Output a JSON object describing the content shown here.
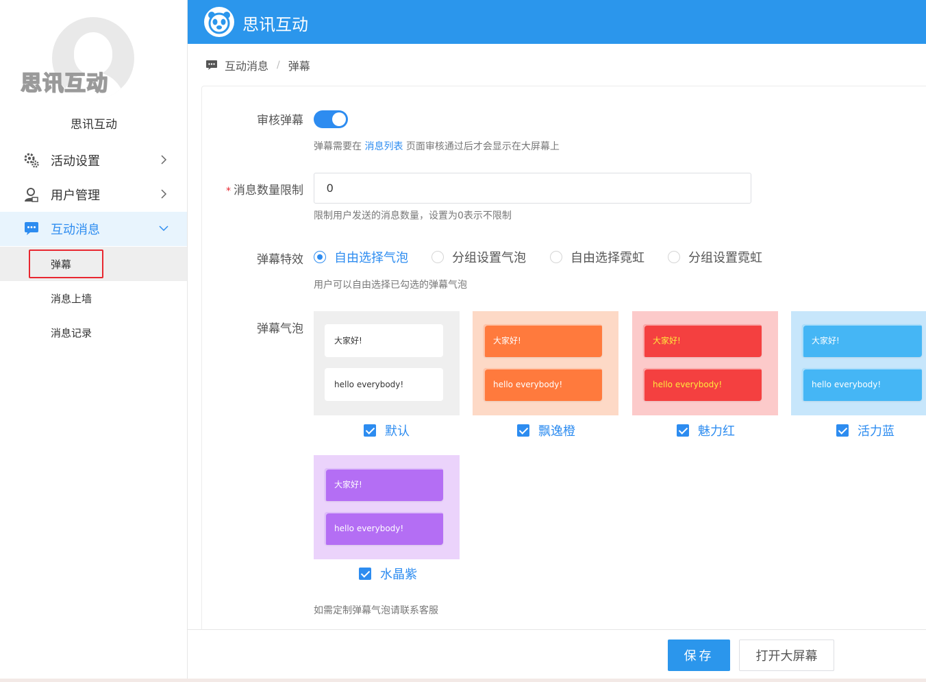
{
  "sidebar": {
    "avatar_logo_text": "思讯互动",
    "account_name": "思讯互动",
    "nav": [
      {
        "label": "活动设置",
        "icon": "gears-icon"
      },
      {
        "label": "用户管理",
        "icon": "user-manage-icon"
      },
      {
        "label": "互动消息",
        "icon": "chat-bubble-icon",
        "active": true
      }
    ],
    "sub_items": [
      {
        "label": "弹幕",
        "selected": true
      },
      {
        "label": "消息上墙"
      },
      {
        "label": "消息记录"
      }
    ]
  },
  "header": {
    "title": "思讯互动",
    "logo_icon": "panda-logo-icon",
    "color": "#2b96ec"
  },
  "breadcrumb": {
    "icon": "chat-icon",
    "parent": "互动消息",
    "separator": "/",
    "current": "弹幕"
  },
  "form": {
    "review": {
      "label": "审核弹幕",
      "enabled": true,
      "help_prefix": "弹幕需要在",
      "help_link": "消息列表",
      "help_suffix": "页面审核通过后才会显示在大屏幕上"
    },
    "limit": {
      "required_mark": "*",
      "label": "消息数量限制",
      "value": "0",
      "help": "限制用户发送的消息数量，设置为0表示不限制"
    },
    "effect": {
      "label": "弹幕特效",
      "options": [
        "自由选择气泡",
        "分组设置气泡",
        "自由选择霓虹",
        "分组设置霓虹"
      ],
      "selected": "自由选择气泡",
      "help": "用户可以自由选择已勾选的弹幕气泡"
    },
    "bubbles": {
      "label": "弹幕气泡",
      "line1": "大家好!",
      "line2": "hello everybody!",
      "items": [
        {
          "name": "默认",
          "checked": true,
          "bg": "#efefef",
          "bubble": "#ffffff",
          "text": "#333333"
        },
        {
          "name": "飘逸橙",
          "checked": true,
          "bg": "#fdd9c6",
          "bubble": "#ff7a3d",
          "text": "#ffffff"
        },
        {
          "name": "魅力红",
          "checked": true,
          "bg": "#fccaca",
          "bubble": "#f44040",
          "text": "#ffea3d"
        },
        {
          "name": "活力蓝",
          "checked": true,
          "bg": "#c7e6fb",
          "bubble": "#45b6f5",
          "text": "#ffffff"
        },
        {
          "name": "水晶紫",
          "checked": true,
          "bg": "#ebd3fb",
          "bubble": "#b46ef4",
          "text": "#ffffff"
        }
      ],
      "help": "如需定制弹幕气泡请联系客服"
    }
  },
  "footer": {
    "save_label": "保存",
    "open_screen_label": "打开大屏幕"
  }
}
